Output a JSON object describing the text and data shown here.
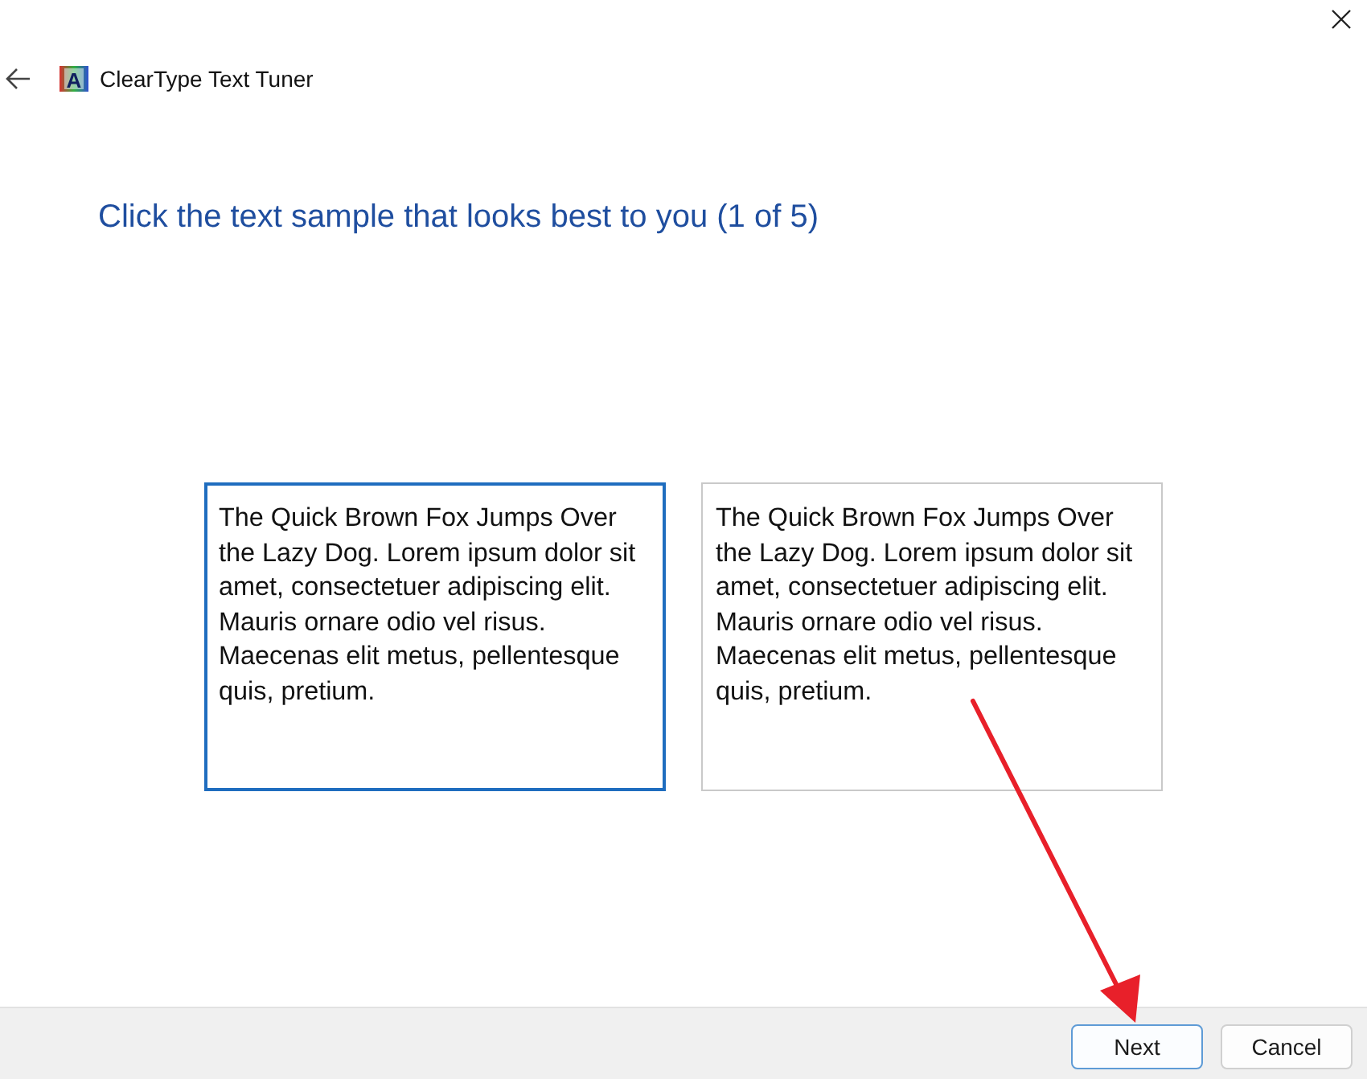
{
  "window": {
    "title": "ClearType Text Tuner",
    "app_icon_glyph": "A"
  },
  "heading": "Click the text sample that looks best to you (1 of 5)",
  "samples": [
    {
      "text": "The Quick Brown Fox Jumps Over the Lazy Dog. Lorem ipsum dolor sit amet, consectetuer adipiscing elit. Mauris ornare odio vel risus. Maecenas elit metus, pellentesque quis, pretium.",
      "selected": true
    },
    {
      "text": "The Quick Brown Fox Jumps Over the Lazy Dog. Lorem ipsum dolor sit amet, consectetuer adipiscing elit. Mauris ornare odio vel risus. Maecenas elit metus, pellentesque quis, pretium.",
      "selected": false
    }
  ],
  "buttons": [
    {
      "label": "Next",
      "default": true
    },
    {
      "label": "Cancel",
      "default": false
    }
  ]
}
